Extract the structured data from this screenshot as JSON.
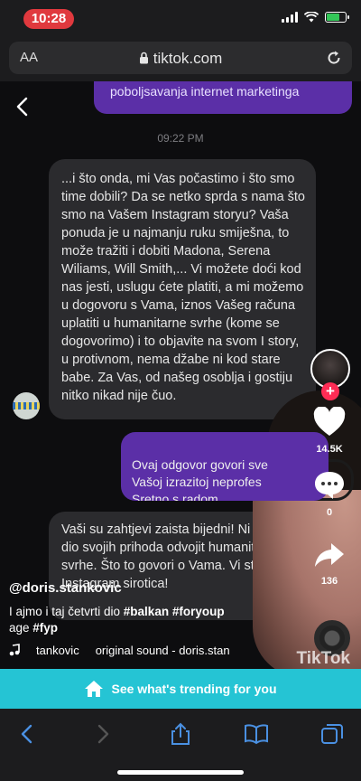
{
  "status_bar": {
    "time": "10:28"
  },
  "browser": {
    "text_size_label": "AA",
    "url": "tiktok.com"
  },
  "chat": {
    "prev_outgoing": "poboljsavanja internet marketinga",
    "timestamp": "09:22 PM",
    "incoming_1": "...i što onda, mi Vas počastimo i što smo time dobili? Da se netko sprda s nama što smo na Vašem Instagram storyu? Vaša ponuda je u najmanju ruku smiješna, to može tražiti i dobiti Madona, Serena Wiliams, Will Smith,... Vi možete doći kod nas jesti, uslugu ćete platiti, a mi možemo u dogovoru s Vama, iznos Vašeg računa uplatiti u humanitarne svrhe (kome se dogovorimo) i to objavite na svom I story, u protivnom, nema džabe ni kod stare babe. Za Vas, od našeg osoblja i gostiju nitko nikad nije čuo.",
    "outgoing": "Ovaj odgovor govori sve\nVašoj izrazitoj neprofes\nSretno s radom",
    "incoming_2": "Vaši su zahtjevi zaista bijedni! Ni spremni dio svojih prihoda odvojit humanitarne svrhe. Što to govori o Vama. Vi ste obična Instagram sirotica!"
  },
  "video": {
    "username": "@doris.stankovic",
    "caption_text": "I ajmo i taj četvrti dio ",
    "hashtags": [
      "#balkan",
      "#foryoup",
      "#fyp"
    ],
    "caption_line2_prefix": "age ",
    "sound_artist": "tankovic",
    "sound_title": "original sound - doris.stan",
    "watermark": "TikTok",
    "likes": "14.5K",
    "comments": "0",
    "shares": "136"
  },
  "cta": {
    "label": "See what's trending for you"
  },
  "colors": {
    "accent": "#25c4d4",
    "bubble_out": "#5b2fa7",
    "bubble_in": "#2b2b2e",
    "like_dot": "#fe2c55",
    "status_pill": "#e0393e"
  }
}
